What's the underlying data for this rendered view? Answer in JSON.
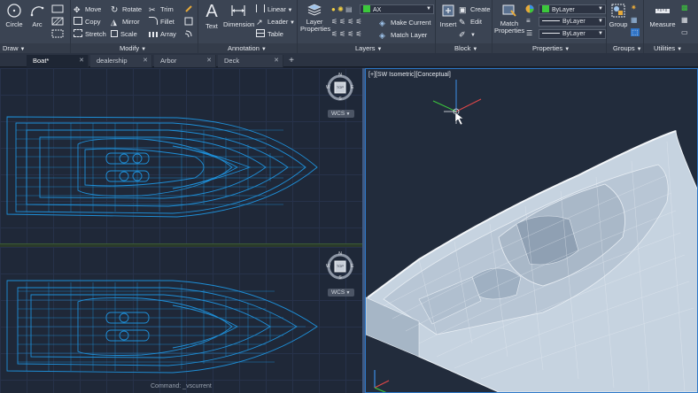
{
  "ribbon": {
    "draw": {
      "title": "Draw",
      "circle": "Circle",
      "arc": "Arc"
    },
    "modify": {
      "title": "Modify",
      "move": "Move",
      "rotate": "Rotate",
      "trim": "Trim",
      "copy": "Copy",
      "mirror": "Mirror",
      "fillet": "Fillet",
      "stretch": "Stretch",
      "scale": "Scale",
      "array": "Array"
    },
    "annotation": {
      "title": "Annotation",
      "text": "Text",
      "dimension": "Dimension",
      "linear": "Linear",
      "leader": "Leader",
      "table": "Table"
    },
    "layers": {
      "title": "Layers",
      "layer_properties": "Layer Properties",
      "current_layer": "AX",
      "make_current": "Make Current",
      "match_layer": "Match Layer"
    },
    "block": {
      "title": "Block",
      "insert": "Insert",
      "create": "Create",
      "edit": "Edit"
    },
    "properties": {
      "title": "Properties",
      "match_properties": "Match Properties",
      "color": "ByLayer",
      "linetype": "ByLayer",
      "lineweight": "ByLayer"
    },
    "groups": {
      "title": "Groups",
      "group": "Group"
    },
    "utilities": {
      "title": "Utilities",
      "measure": "Measure"
    },
    "colors": {
      "layer_green": "#3cc83c",
      "bylayer_green": "#3cc83c"
    }
  },
  "tabs": [
    {
      "label": "Boat*"
    },
    {
      "label": "dealership"
    },
    {
      "label": "Arbor"
    },
    {
      "label": "Deck"
    }
  ],
  "viewports": {
    "iso_label": "[+][SW Isometric][Conceptual]",
    "top_cube_face": "TOP",
    "compass": {
      "n": "N",
      "s": "S",
      "e": "E",
      "w": "W"
    },
    "wcs_label": "WCS"
  },
  "command_line": "Command: _vscurrent",
  "colors": {
    "wireframe": "#1e8fd8",
    "viewport_border": "#2d78c8"
  }
}
